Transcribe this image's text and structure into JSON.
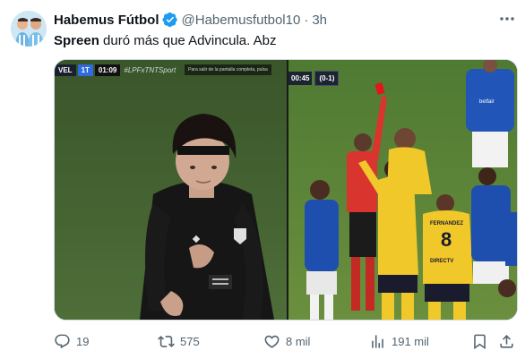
{
  "author": {
    "name": "Habemus Fútbol",
    "handle": "@Habemusfutbol10",
    "time": "3h",
    "separator": "·"
  },
  "tweet": {
    "text_bold": "Spreen",
    "text_rest": " duró más que Advincula. Abz"
  },
  "media": {
    "left_scorebug": {
      "team": "VEL",
      "half": "1T",
      "clock": "01:09",
      "tag": "#LPFxTNTSport",
      "note": "Para salir de la pantalla completa, pulsa"
    },
    "right_scorebug": {
      "clock": "00:45",
      "score": "(0-1)"
    },
    "jersey_number": "8",
    "jersey_name": "FERNANDEZ",
    "sponsor": "DIRECTV",
    "sponsor_right": "betfair"
  },
  "actions": {
    "replies": "19",
    "reposts": "575",
    "likes": "8 mil",
    "views": "191 mil"
  },
  "colors": {
    "accent": "#1d9bf0",
    "muted": "#536471",
    "text": "#0f1419"
  }
}
